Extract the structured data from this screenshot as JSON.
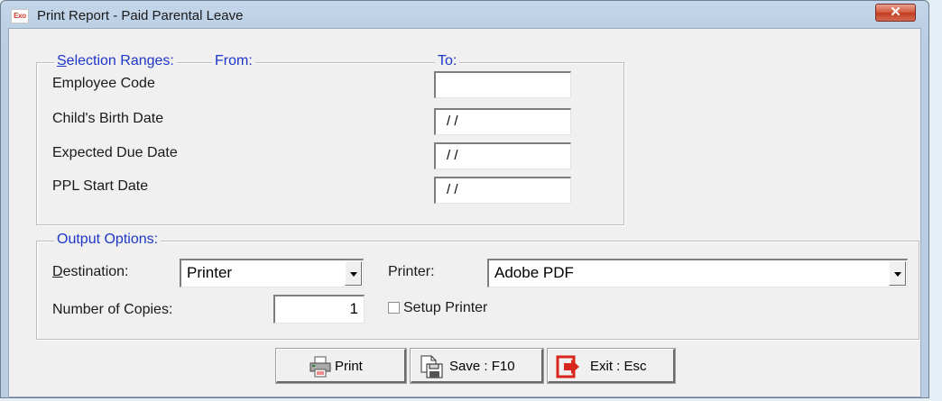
{
  "window": {
    "title": "Print Report - Paid Parental Leave",
    "app_icon_text": "Exo",
    "close_symbol": "✕"
  },
  "selection": {
    "legend_prefix": "S",
    "legend_rest": "election Ranges:",
    "from_label": "From:",
    "to_label": "To:",
    "rows": [
      {
        "label": "Employee Code",
        "to_value": ""
      },
      {
        "label": "Child's Birth Date",
        "to_value": "/ /"
      },
      {
        "label": "Expected Due Date",
        "to_value": "/ /"
      },
      {
        "label": "PPL Start Date",
        "to_value": "/ /"
      }
    ]
  },
  "output": {
    "legend": "Output Options:",
    "destination_prefix": "D",
    "destination_rest": "estination:",
    "destination_value": "Printer",
    "printer_label": "Printer:",
    "printer_value": "Adobe PDF",
    "copies_label": "Number of Copies:",
    "copies_value": "1",
    "setup_printer_label": "Setup Printer",
    "setup_printer_checked": false
  },
  "buttons": {
    "print": "Print",
    "save": "Save : F10",
    "exit": "Exit : Esc"
  },
  "icons": {
    "print": "printer-icon",
    "save": "save-icon",
    "exit": "exit-icon",
    "close": "close-icon"
  },
  "colors": {
    "legend": "#1e36c8",
    "close_button": "#c13d22",
    "exit_icon": "#d9261c"
  }
}
